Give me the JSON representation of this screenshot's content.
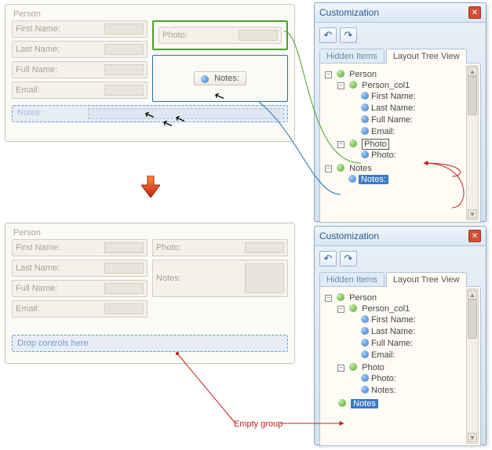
{
  "form1": {
    "title": "Person",
    "fields_left": [
      "First Name:",
      "Last Name:",
      "Full Name:",
      "Email:"
    ],
    "photo_label": "Photo:",
    "notes_chip": "Notes:",
    "notes_zone_label": "Notes:"
  },
  "form2": {
    "title": "Person",
    "fields_left": [
      "First Name:",
      "Last Name:",
      "Full Name:",
      "Email:"
    ],
    "fields_right": [
      "Photo:",
      "Notes:"
    ],
    "drop_hint": "Drop controls here"
  },
  "cust": {
    "title": "Customization",
    "tabs": {
      "hidden": "Hidden Items",
      "tree": "Layout Tree View"
    }
  },
  "tree1": {
    "person": "Person",
    "col1": "Person_col1",
    "first": "First Name:",
    "last": "Last Name:",
    "full": "Full Name:",
    "email": "Email:",
    "photo_group": "Photo",
    "photo_item": "Photo:",
    "notes_group": "Notes",
    "notes_item": "Notes:"
  },
  "tree2": {
    "person": "Person",
    "col1": "Person_col1",
    "first": "First Name:",
    "last": "Last Name:",
    "full": "Full Name:",
    "email": "Email:",
    "photo_group": "Photo",
    "photo_item": "Photo:",
    "notes_item": "Notes:",
    "notes_group": "Notes"
  },
  "annotations": {
    "empty_group": "Empty group"
  }
}
